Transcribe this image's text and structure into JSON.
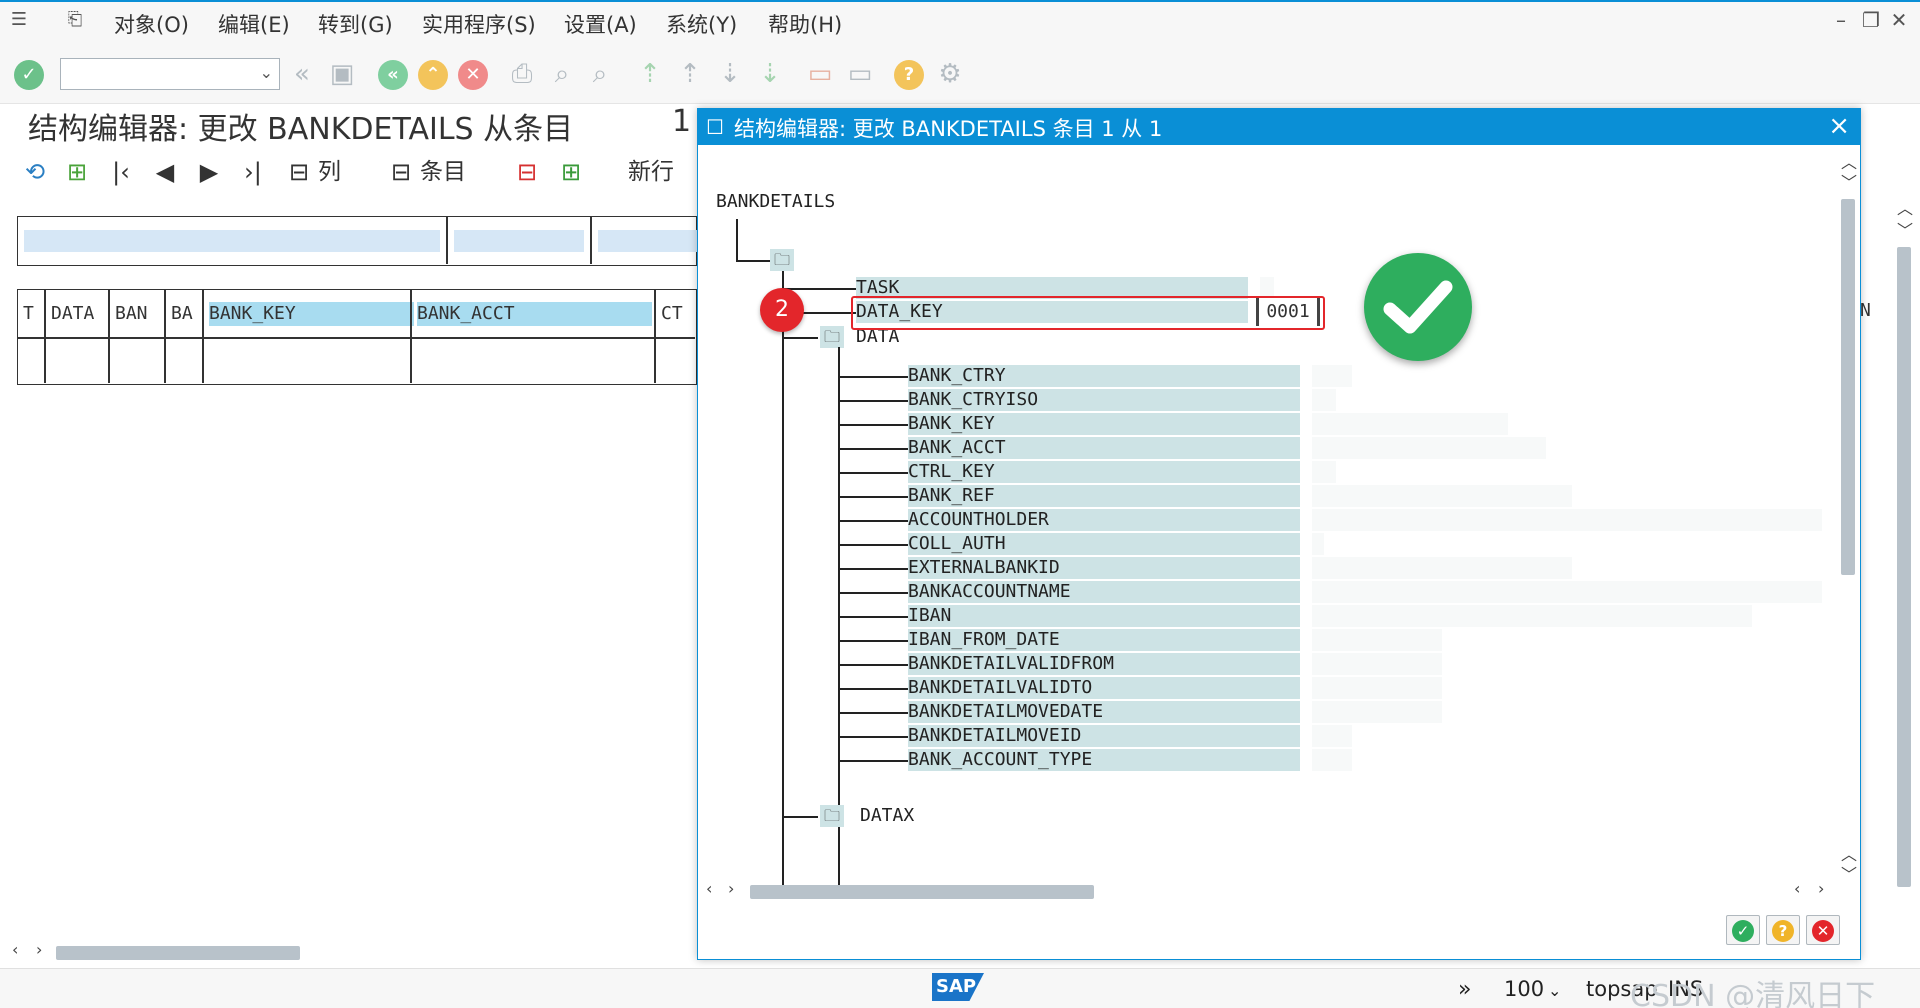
{
  "menu": {
    "items": [
      "对象(O)",
      "编辑(E)",
      "转到(G)",
      "实用程序(S)",
      "设置(A)",
      "系统(Y)",
      "帮助(H)"
    ]
  },
  "background_window": {
    "title": "结构编辑器: 更改 BANKDETAILS 从条目",
    "title_number": "1",
    "app_toolbar": {
      "column_label": "列",
      "entry_label": "条目",
      "new_row_label": "新行"
    },
    "table_headers": [
      "T",
      "DATA",
      "BAN",
      "BA",
      "BANK_KEY",
      "BANK_ACCT",
      "CT"
    ],
    "right_partial_header": "N"
  },
  "dialog": {
    "title": "结构编辑器: 更改 BANKDETAILS 条目 1 从 1",
    "root_label": "BANKDETAILS",
    "top_fields": [
      {
        "label": "TASK",
        "value": ""
      },
      {
        "label": "DATA_KEY",
        "value": "0001"
      }
    ],
    "data_label": "DATA",
    "data_fields": [
      "BANK_CTRY",
      "BANK_CTRYISO",
      "BANK_KEY",
      "BANK_ACCT",
      "CTRL_KEY",
      "BANK_REF",
      "ACCOUNTHOLDER",
      "COLL_AUTH",
      "EXTERNALBANKID",
      "BANKACCOUNTNAME",
      "IBAN",
      "IBAN_FROM_DATE",
      "BANKDETAILVALIDFROM",
      "BANKDETAILVALIDTO",
      "BANKDETAILMOVEDATE",
      "BANKDETAILMOVEID",
      "BANK_ACCOUNT_TYPE"
    ],
    "datax_label": "DATAX",
    "step_badge": "2"
  },
  "status": {
    "zoom": "100",
    "system": "topsap",
    "mode": "INS",
    "watermark": "CSDN @清风日下"
  },
  "colors": {
    "sap_blue": "#0a8fd6",
    "highlight_red": "#e3262b",
    "success_green": "#2eae5e",
    "tree_bar": "#cde3e5"
  }
}
